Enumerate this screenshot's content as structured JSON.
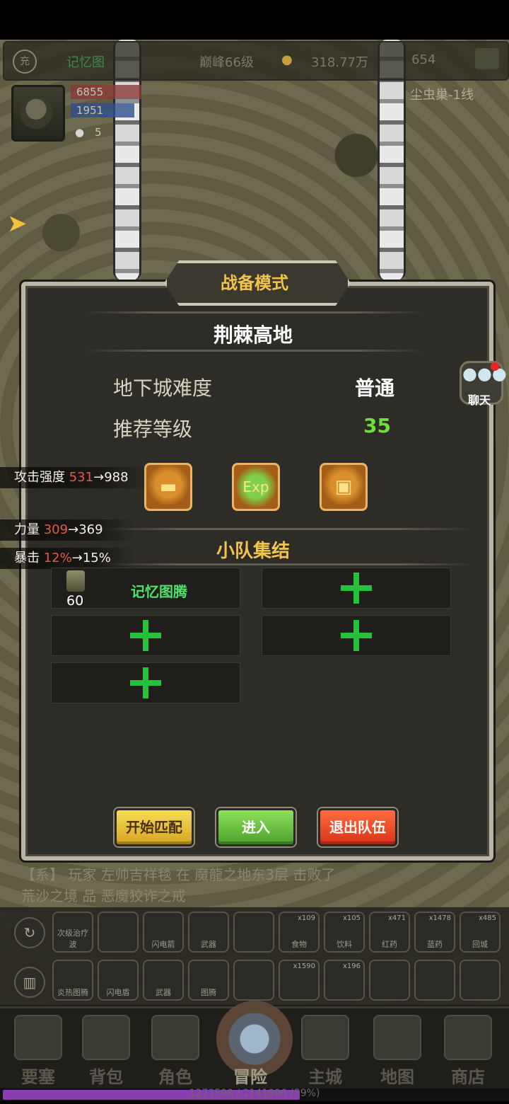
{
  "hud": {
    "charge_label": "充",
    "player_name": "记忆图",
    "peak_level": "巅峰66级",
    "gold": "318.77万",
    "gems": "654",
    "hp": "6855",
    "mp": "1951",
    "misc": "5",
    "zone": "尘虫巢-1线"
  },
  "dialog": {
    "mode_title": "战备模式",
    "dungeon_name": "荆棘高地",
    "difficulty_label": "地下城难度",
    "difficulty_value": "普通",
    "recommended_label": "推荐等级",
    "recommended_value": "35",
    "rewards": [
      {
        "name": "gold-reward",
        "glyph": "▬"
      },
      {
        "name": "exp-reward",
        "glyph": "Exp"
      },
      {
        "name": "chest-reward",
        "glyph": "▣"
      }
    ],
    "party_title": "小队集结",
    "member": {
      "level": "60",
      "name": "记忆图腾"
    },
    "buttons": {
      "start_match": "开始匹配",
      "enter": "进入",
      "leave": "退出队伍"
    }
  },
  "stat_changes": [
    {
      "label": "攻击强度",
      "from": "531",
      "arrow": "→",
      "to": "988"
    },
    {
      "label": "力量",
      "from": "309",
      "arrow": "→",
      "to": "369"
    },
    {
      "label": "暴击",
      "from": "12%",
      "arrow": "→",
      "to": "15%"
    }
  ],
  "chat": {
    "label": "聊天"
  },
  "log": {
    "line1": "【系】 玩家 左帅吉祥毯 在 魔龍之地东3层 击败了",
    "line2": "荒沙之境 品 恶魔狡诈之戒"
  },
  "skills_row1": [
    {
      "label": "次级治疗波",
      "count": ""
    },
    {
      "label": "",
      "count": ""
    },
    {
      "label": "闪电箭",
      "count": ""
    },
    {
      "label": "武器",
      "count": ""
    },
    {
      "label": "",
      "count": ""
    },
    {
      "label": "食物",
      "count": "x109"
    },
    {
      "label": "饮料",
      "count": "x105"
    },
    {
      "label": "红药",
      "count": "x471"
    },
    {
      "label": "蓝药",
      "count": "x1478"
    },
    {
      "label": "回城",
      "count": "x485"
    }
  ],
  "skills_row2": [
    {
      "label": "炎热图腾",
      "count": ""
    },
    {
      "label": "闪电盾",
      "count": ""
    },
    {
      "label": "武器",
      "count": ""
    },
    {
      "label": "图腾",
      "count": ""
    },
    {
      "label": "",
      "count": ""
    },
    {
      "label": "",
      "count": "x1590"
    },
    {
      "label": "",
      "count": "x196"
    },
    {
      "label": "",
      "count": ""
    },
    {
      "label": "",
      "count": ""
    },
    {
      "label": "",
      "count": ""
    }
  ],
  "nav": [
    "要塞",
    "背包",
    "角色",
    "冒险",
    "主城",
    "地图",
    "商店"
  ],
  "exp": {
    "text": "1273508 / 2141996 (59%)",
    "fraction": 0.59
  }
}
